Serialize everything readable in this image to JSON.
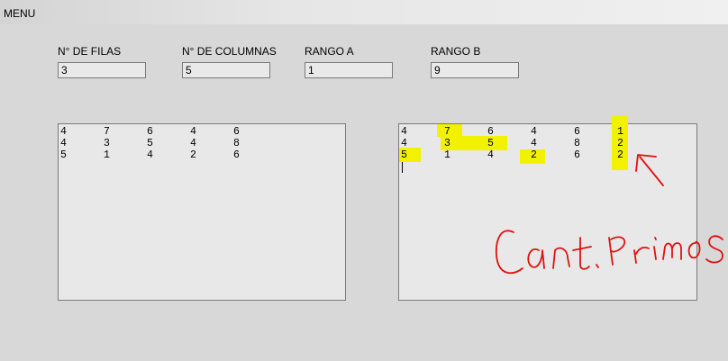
{
  "menu": {
    "label": "MENU"
  },
  "fields": {
    "filas": {
      "label": "N° DE FILAS",
      "value": "3"
    },
    "columnas": {
      "label": "N° DE COLUMNAS",
      "value": "5"
    },
    "rango_a": {
      "label": "RANGO A",
      "value": "1"
    },
    "rango_b": {
      "label": "RANGO B",
      "value": "9"
    }
  },
  "matrix_left": [
    [
      "4",
      "7",
      "6",
      "4",
      "6"
    ],
    [
      "4",
      "3",
      "5",
      "4",
      "8"
    ],
    [
      "5",
      "1",
      "4",
      "2",
      "6"
    ]
  ],
  "matrix_right": [
    [
      "4",
      "7",
      "6",
      "4",
      "6",
      "1"
    ],
    [
      "4",
      "3",
      "5",
      "4",
      "8",
      "2"
    ],
    [
      "5",
      "1",
      "4",
      "2",
      "6",
      "2"
    ]
  ],
  "highlight_color": "#f2f200",
  "annotation": {
    "text": "Cant. Primos",
    "color": "#e01010"
  }
}
